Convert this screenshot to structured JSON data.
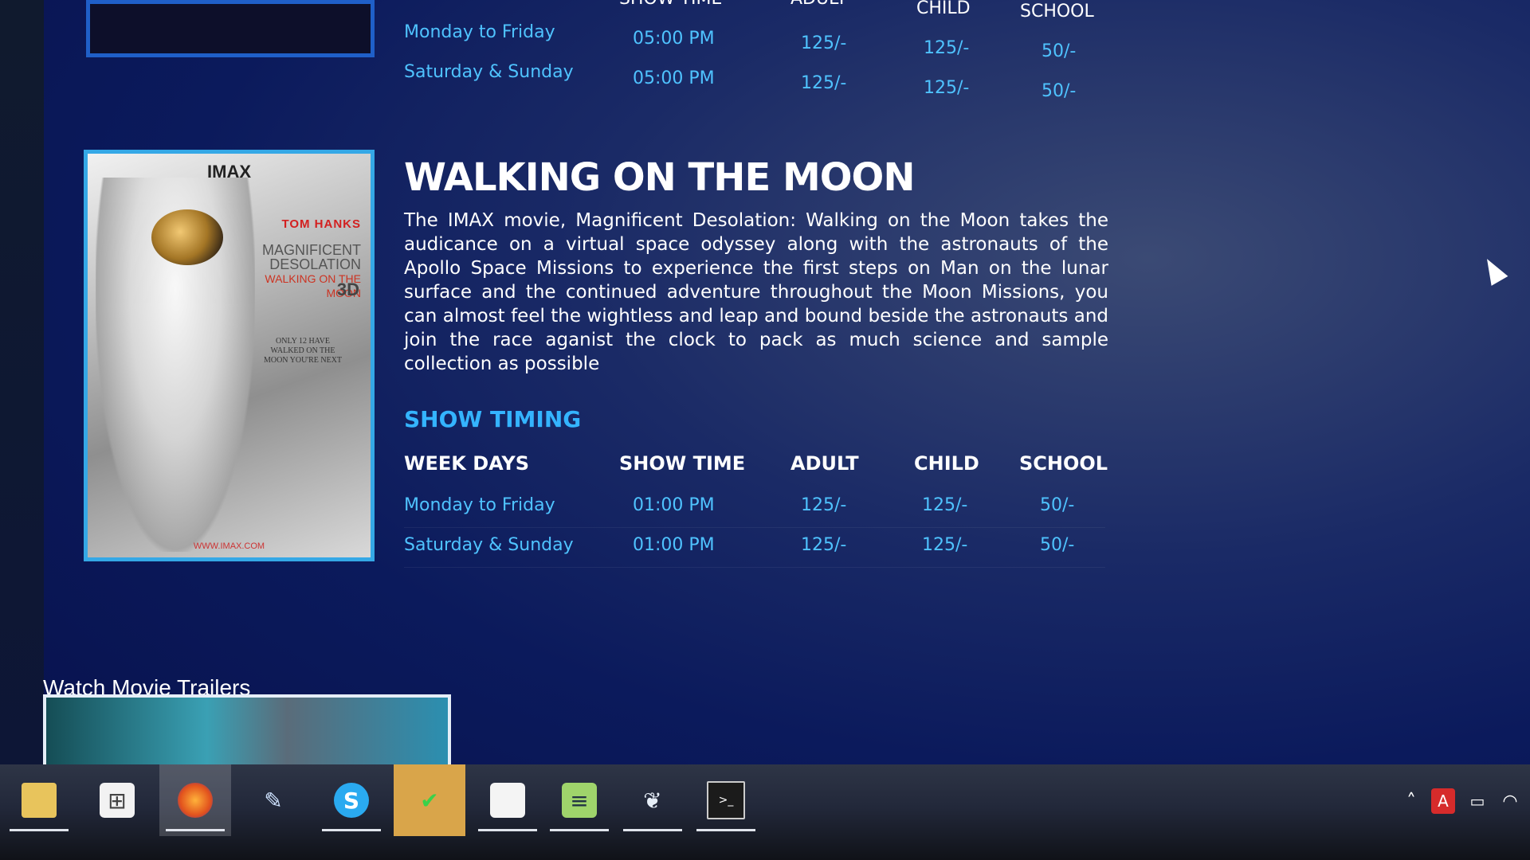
{
  "top_schedule": {
    "headers": [
      "SHOW TIME",
      "ADULT",
      "CHILD",
      "SCHOOL"
    ],
    "rows": [
      {
        "day": "Monday to Friday",
        "time": "05:00 PM",
        "adult": "125/-",
        "child": "125/-",
        "school": "50/-"
      },
      {
        "day": "Saturday & Sunday",
        "time": "05:00 PM",
        "adult": "125/-",
        "child": "125/-",
        "school": "50/-"
      }
    ]
  },
  "movie": {
    "title": "WALKING ON THE MOON",
    "description": "The IMAX movie, Magnificent Desolation: Walking on the Moon takes the audicance on a virtual space odyssey along with the astronauts of the Apollo Space Missions to experience the first steps on Man on the lunar surface and the continued adventure throughout the Moon Missions, you can almost feel the wightless and leap and bound beside the astronauts and join the race aganist the clock to pack as much science and sample collection as possible",
    "poster": {
      "logo": "IMAX",
      "actor": "TOM HANKS",
      "title_line1": "MAGNIFICENT",
      "title_line2": "DESOLATION",
      "title_line3": "WALKING ON THE MOON",
      "format": "3D",
      "tagline": "ONLY 12 HAVE WALKED ON THE MOON YOU'RE NEXT",
      "url": "WWW.IMAX.COM"
    }
  },
  "show_timing": {
    "heading": "SHOW TIMING",
    "headers": [
      "WEEK DAYS",
      "SHOW TIME",
      "ADULT",
      "CHILD",
      "SCHOOL"
    ],
    "rows": [
      {
        "day": "Monday to Friday",
        "time": "01:00 PM",
        "adult": "125/-",
        "child": "125/-",
        "school": "50/-"
      },
      {
        "day": "Saturday & Sunday",
        "time": "01:00 PM",
        "adult": "125/-",
        "child": "125/-",
        "school": "50/-"
      }
    ]
  },
  "trailers": {
    "heading": "Watch Movie Trailers"
  },
  "taskbar": {
    "apps": [
      {
        "name": "file-explorer",
        "icon": "folder-icon"
      },
      {
        "name": "store",
        "icon": "windows-store-icon"
      },
      {
        "name": "firefox",
        "icon": "firefox-icon"
      },
      {
        "name": "notes",
        "icon": "pen-notes-icon"
      },
      {
        "name": "skype",
        "icon": "skype-icon"
      },
      {
        "name": "chat",
        "icon": "chat-check-icon"
      },
      {
        "name": "sticky-notes",
        "icon": "sticky-note-icon"
      },
      {
        "name": "notepad",
        "icon": "notepad-icon"
      },
      {
        "name": "app-bird",
        "icon": "bird-icon"
      },
      {
        "name": "command-prompt",
        "icon": "terminal-icon"
      }
    ],
    "tray_icons": [
      "chevron-up-icon",
      "acrobat-icon",
      "battery-icon",
      "wifi-icon"
    ]
  },
  "colors": {
    "background": "#0b1a5c",
    "accent_cyan": "#4fc3ff",
    "heading_blue": "#34b4ff",
    "poster_border": "#35a8e6"
  }
}
